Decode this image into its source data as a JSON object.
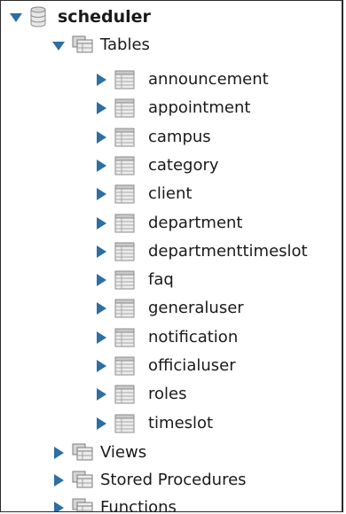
{
  "schema": {
    "name": "scheduler",
    "icon": "database-icon",
    "expanded": true
  },
  "tables_group": {
    "label": "Tables",
    "icon": "folder-table-icon",
    "expanded": true,
    "items": [
      {
        "name": "announcement"
      },
      {
        "name": "appointment"
      },
      {
        "name": "campus"
      },
      {
        "name": "category"
      },
      {
        "name": "client"
      },
      {
        "name": "department"
      },
      {
        "name": "departmenttimeslot"
      },
      {
        "name": "faq"
      },
      {
        "name": "generaluser"
      },
      {
        "name": "notification"
      },
      {
        "name": "officialuser"
      },
      {
        "name": "roles"
      },
      {
        "name": "timeslot"
      }
    ]
  },
  "other_groups": [
    {
      "label": "Views",
      "icon": "folder-views-icon",
      "expanded": false
    },
    {
      "label": "Stored Procedures",
      "icon": "folder-procedures-icon",
      "expanded": false
    },
    {
      "label": "Functions",
      "icon": "folder-functions-icon",
      "expanded": false
    }
  ],
  "colors": {
    "arrow": "#2d6ea3",
    "icon_fill": "#e3e3e3",
    "icon_border": "#8c8c8c"
  }
}
